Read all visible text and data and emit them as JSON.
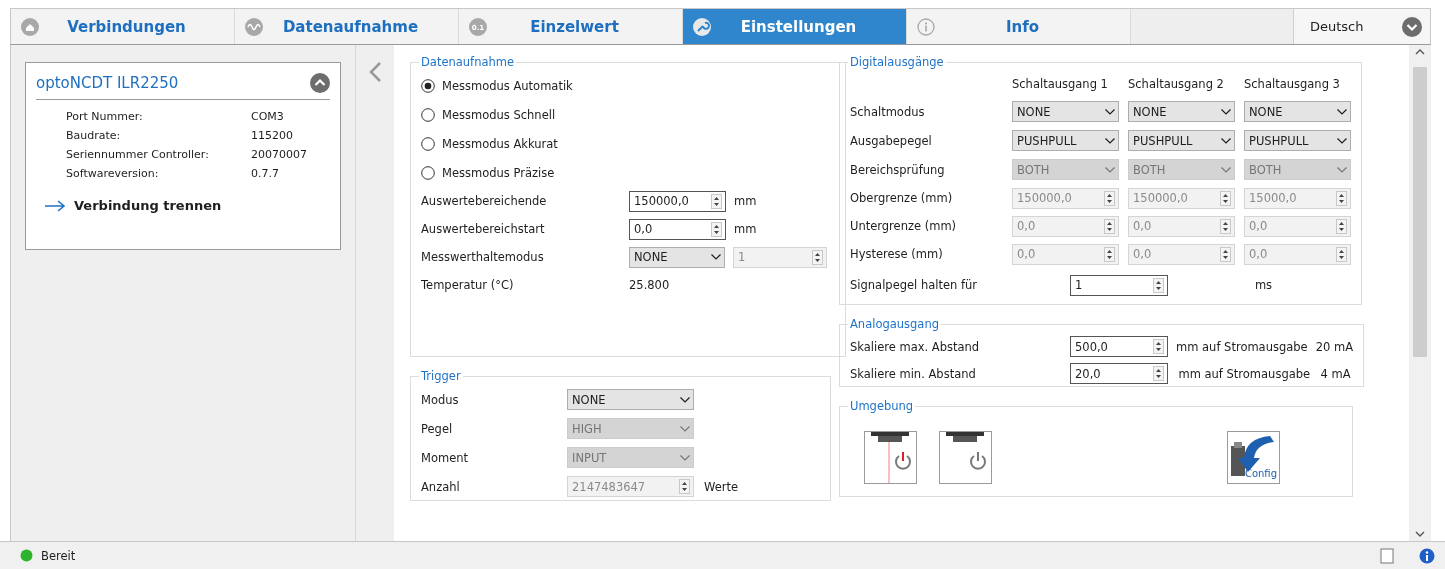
{
  "tabs": [
    {
      "label": "Verbindungen",
      "selected": false
    },
    {
      "label": "Datenaufnahme",
      "selected": false
    },
    {
      "label": "Einzelwert",
      "icon_text": "0.1",
      "selected": false
    },
    {
      "label": "Einstellungen",
      "selected": true
    },
    {
      "label": "Info",
      "selected": false
    }
  ],
  "language": {
    "value": "Deutsch"
  },
  "device": {
    "title": "optoNCDT ILR2250",
    "expanded": true,
    "fields": [
      {
        "label": "Port Nummer:",
        "value": "COM3"
      },
      {
        "label": "Baudrate:",
        "value": "115200"
      },
      {
        "label": "Seriennummer Controller:",
        "value": "20070007"
      },
      {
        "label": "Softwareversion:",
        "value": "0.7.7"
      }
    ],
    "action": "Verbindung trennen"
  },
  "datenaufnahme": {
    "title": "Datenaufnahme",
    "modes": [
      {
        "label": "Messmodus Automatik",
        "selected": true
      },
      {
        "label": "Messmodus Schnell",
        "selected": false
      },
      {
        "label": "Messmodus Akkurat",
        "selected": false
      },
      {
        "label": "Messmodus Präzise",
        "selected": false
      }
    ],
    "rows": [
      {
        "label": "Auswertebereichende",
        "controls": [
          {
            "kind": "spin",
            "value": "150000,0",
            "disabled": false
          }
        ],
        "unit": "mm"
      },
      {
        "label": "Auswertebereichstart",
        "controls": [
          {
            "kind": "spin",
            "value": "0,0",
            "disabled": false
          }
        ],
        "unit": "mm"
      },
      {
        "label": "Messwerthaltemodus",
        "controls": [
          {
            "kind": "combo",
            "value": "NONE",
            "disabled": false
          },
          {
            "kind": "spin",
            "value": "1",
            "disabled": true
          }
        ]
      },
      {
        "label": "Temperatur (°C)",
        "controls": [
          {
            "kind": "text",
            "value": "25.800"
          }
        ]
      }
    ]
  },
  "trigger": {
    "title": "Trigger",
    "rows": [
      {
        "label": "Modus",
        "controls": [
          {
            "kind": "combo",
            "value": "NONE",
            "disabled": false
          }
        ]
      },
      {
        "label": "Pegel",
        "controls": [
          {
            "kind": "combo",
            "value": "HIGH",
            "disabled": true
          }
        ]
      },
      {
        "label": "Moment",
        "controls": [
          {
            "kind": "combo",
            "value": "INPUT",
            "disabled": true
          }
        ]
      },
      {
        "label": "Anzahl",
        "controls": [
          {
            "kind": "spin",
            "value": "2147483647",
            "disabled": true
          }
        ],
        "unit": "Werte"
      }
    ]
  },
  "digital": {
    "title": "Digitalausgänge",
    "columns": [
      "Schaltausgang 1",
      "Schaltausgang 2",
      "Schaltausgang 3"
    ],
    "rows": [
      {
        "label": "Schaltmodus",
        "cells": [
          {
            "kind": "combo",
            "value": "NONE",
            "disabled": false
          },
          {
            "kind": "combo",
            "value": "NONE",
            "disabled": false
          },
          {
            "kind": "combo",
            "value": "NONE",
            "disabled": false
          }
        ]
      },
      {
        "label": "Ausgabepegel",
        "cells": [
          {
            "kind": "combo",
            "value": "PUSHPULL",
            "disabled": false
          },
          {
            "kind": "combo",
            "value": "PUSHPULL",
            "disabled": false
          },
          {
            "kind": "combo",
            "value": "PUSHPULL",
            "disabled": false
          }
        ]
      },
      {
        "label": "Bereichsprüfung",
        "cells": [
          {
            "kind": "combo",
            "value": "BOTH",
            "disabled": true
          },
          {
            "kind": "combo",
            "value": "BOTH",
            "disabled": true
          },
          {
            "kind": "combo",
            "value": "BOTH",
            "disabled": true
          }
        ]
      },
      {
        "label": "Obergrenze (mm)",
        "cells": [
          {
            "kind": "spin",
            "value": "150000,0",
            "disabled": true
          },
          {
            "kind": "spin",
            "value": "150000,0",
            "disabled": true
          },
          {
            "kind": "spin",
            "value": "15000,0",
            "disabled": true
          }
        ]
      },
      {
        "label": "Untergrenze (mm)",
        "cells": [
          {
            "kind": "spin",
            "value": "0,0",
            "disabled": true
          },
          {
            "kind": "spin",
            "value": "0,0",
            "disabled": true
          },
          {
            "kind": "spin",
            "value": "0,0",
            "disabled": true
          }
        ]
      },
      {
        "label": "Hysterese (mm)",
        "cells": [
          {
            "kind": "spin",
            "value": "0,0",
            "disabled": true
          },
          {
            "kind": "spin",
            "value": "0,0",
            "disabled": true
          },
          {
            "kind": "spin",
            "value": "0,0",
            "disabled": true
          }
        ]
      }
    ],
    "hold": {
      "label": "Signalpegel halten für",
      "value": "1",
      "unit": "ms"
    }
  },
  "analog": {
    "title": "Analogausgang",
    "rows": [
      {
        "label": "Skaliere max. Abstand",
        "value": "500,0",
        "unit": "mm auf Stromausgabe",
        "current": "20 mA"
      },
      {
        "label": "Skaliere min. Abstand",
        "value": "20,0",
        "unit": "mm auf Stromausgabe",
        "current": "4 mA"
      }
    ]
  },
  "umgebung": {
    "title": "Umgebung",
    "buttons": [
      {
        "kind": "laser_on"
      },
      {
        "kind": "laser_off"
      },
      {
        "kind": "config",
        "label": "Config"
      }
    ]
  },
  "status_bar": {
    "text": "Bereit"
  }
}
